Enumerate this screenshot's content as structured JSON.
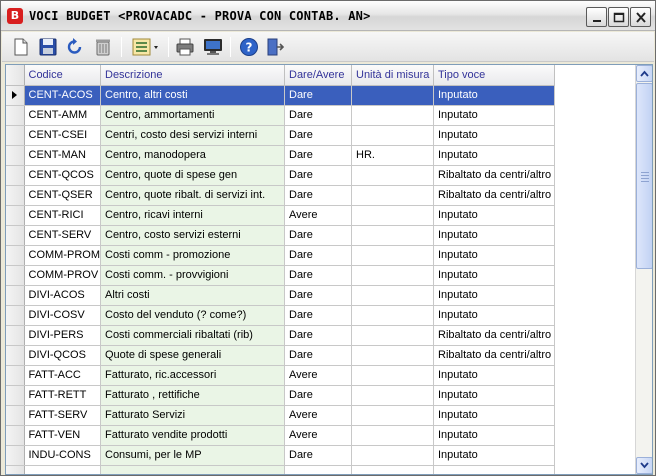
{
  "window": {
    "app_icon_letter": "B",
    "title": "VOCI BUDGET <PROVACADC - PROVA CON CONTAB. AN>"
  },
  "toolbar": {
    "buttons": [
      "new-document-icon",
      "save-icon",
      "undo-icon",
      "delete-icon",
      "view-list-icon",
      "print-icon",
      "preview-icon",
      "help-icon",
      "exit-icon"
    ]
  },
  "grid": {
    "columns": [
      "Codice",
      "Descrizione",
      "Dare/Avere",
      "Unità di misura",
      "Tipo voce"
    ],
    "selected_row": 0,
    "rows": [
      {
        "codice": "CENT-ACOS",
        "descrizione": "Centro, altri costi",
        "dare_avere": "Dare",
        "um": "",
        "tipo": "Inputato"
      },
      {
        "codice": "CENT-AMM",
        "descrizione": "Centro, ammortamenti",
        "dare_avere": "Dare",
        "um": "",
        "tipo": "Inputato"
      },
      {
        "codice": "CENT-CSEI",
        "descrizione": "Centri, costo desi servizi interni",
        "dare_avere": "Dare",
        "um": "",
        "tipo": "Inputato"
      },
      {
        "codice": "CENT-MAN",
        "descrizione": "Centro, manodopera",
        "dare_avere": "Dare",
        "um": "HR.",
        "tipo": "Inputato"
      },
      {
        "codice": "CENT-QCOS",
        "descrizione": "Centro, quote di spese gen",
        "dare_avere": "Dare",
        "um": "",
        "tipo": "Ribaltato da centri/altro"
      },
      {
        "codice": "CENT-QSER",
        "descrizione": "Centro, quote ribalt. di servizi int.",
        "dare_avere": "Dare",
        "um": "",
        "tipo": "Ribaltato da centri/altro"
      },
      {
        "codice": "CENT-RICI",
        "descrizione": "Centro, ricavi interni",
        "dare_avere": "Avere",
        "um": "",
        "tipo": "Inputato"
      },
      {
        "codice": "CENT-SERV",
        "descrizione": "Centro, costo servizi esterni",
        "dare_avere": "Dare",
        "um": "",
        "tipo": "Inputato"
      },
      {
        "codice": "COMM-PROM",
        "descrizione": "Costi comm - promozione",
        "dare_avere": "Dare",
        "um": "",
        "tipo": "Inputato"
      },
      {
        "codice": "COMM-PROV",
        "descrizione": "Costi comm. - provvigioni",
        "dare_avere": "Dare",
        "um": "",
        "tipo": "Inputato"
      },
      {
        "codice": "DIVI-ACOS",
        "descrizione": "Altri costi",
        "dare_avere": "Dare",
        "um": "",
        "tipo": "Inputato"
      },
      {
        "codice": "DIVI-COSV",
        "descrizione": "Costo del venduto (? come?)",
        "dare_avere": "Dare",
        "um": "",
        "tipo": "Inputato"
      },
      {
        "codice": "DIVI-PERS",
        "descrizione": "Costi commerciali  ribaltati (rib)",
        "dare_avere": "Dare",
        "um": "",
        "tipo": "Ribaltato da centri/altro"
      },
      {
        "codice": "DIVI-QCOS",
        "descrizione": "Quote di spese generali",
        "dare_avere": "Dare",
        "um": "",
        "tipo": "Ribaltato da centri/altro"
      },
      {
        "codice": "FATT-ACC",
        "descrizione": "Fatturato, ric.accessori",
        "dare_avere": "Avere",
        "um": "",
        "tipo": "Inputato"
      },
      {
        "codice": "FATT-RETT",
        "descrizione": "Fatturato , rettifiche",
        "dare_avere": "Dare",
        "um": "",
        "tipo": "Inputato"
      },
      {
        "codice": "FATT-SERV",
        "descrizione": "Fatturato Servizi",
        "dare_avere": "Avere",
        "um": "",
        "tipo": "Inputato"
      },
      {
        "codice": "FATT-VEN",
        "descrizione": "Fatturato vendite prodotti",
        "dare_avere": "Avere",
        "um": "",
        "tipo": "Inputato"
      },
      {
        "codice": "INDU-CONS",
        "descrizione": "Consumi, per le MP",
        "dare_avere": "Dare",
        "um": "",
        "tipo": "Inputato"
      },
      {
        "codice": "",
        "descrizione": "",
        "dare_avere": "",
        "um": "",
        "tipo": ""
      }
    ]
  },
  "colors": {
    "selection": "#3a5fbd",
    "description_column": "#eaf5e6",
    "header_text": "#333399"
  }
}
